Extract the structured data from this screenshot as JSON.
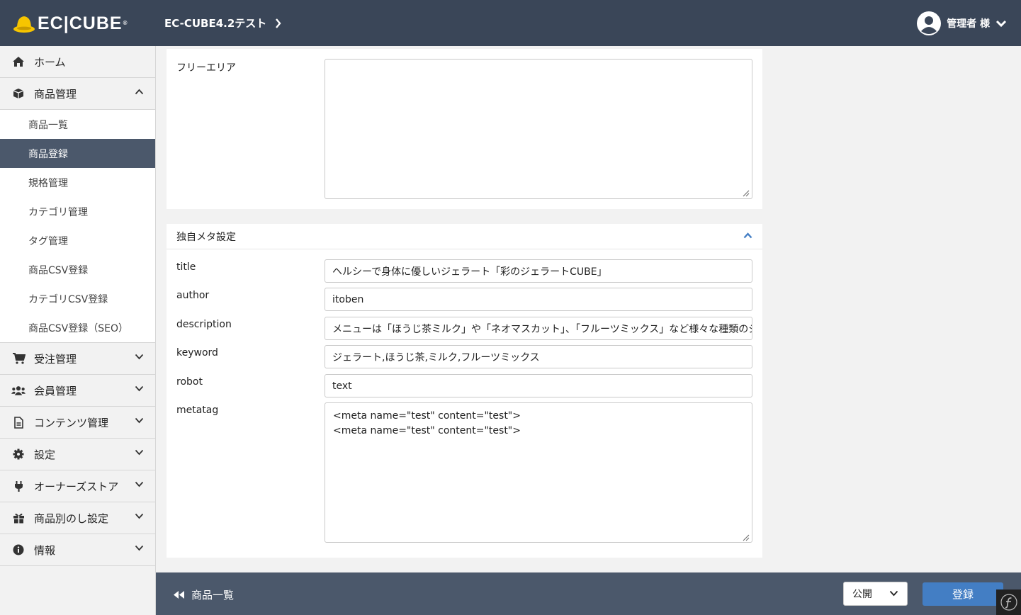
{
  "header": {
    "logo_text": "EC|CUBE",
    "logo_reg": "®",
    "shop_name": "EC-CUBE4.2テスト",
    "user_label": "管理者 様"
  },
  "sidebar": {
    "items": [
      {
        "label": "ホーム",
        "icon": "home-icon"
      },
      {
        "label": "商品管理",
        "icon": "box-icon",
        "expanded": true,
        "children": [
          "商品一覧",
          "商品登録",
          "規格管理",
          "カテゴリ管理",
          "タグ管理",
          "商品CSV登録",
          "カテゴリCSV登録",
          "商品CSV登録（SEO）"
        ],
        "active_child": "商品登録"
      },
      {
        "label": "受注管理",
        "icon": "cart-icon"
      },
      {
        "label": "会員管理",
        "icon": "users-icon"
      },
      {
        "label": "コンテンツ管理",
        "icon": "file-icon"
      },
      {
        "label": "設定",
        "icon": "gear-icon"
      },
      {
        "label": "オーナーズストア",
        "icon": "plug-icon"
      },
      {
        "label": "商品別のし設定",
        "icon": "gift-icon"
      },
      {
        "label": "情報",
        "icon": "info-icon"
      }
    ]
  },
  "free_area": {
    "label": "フリーエリア",
    "value": ""
  },
  "meta_section": {
    "title": "独自メタ設定",
    "fields": {
      "title": {
        "label": "title",
        "value": "ヘルシーで身体に優しいジェラート「彩のジェラートCUBE」"
      },
      "author": {
        "label": "author",
        "value": "itoben"
      },
      "description": {
        "label": "description",
        "value": "メニューは「ほうじ茶ミルク」や「ネオマスカット」、「フルーツミックス」など様々な種類のジェラートが用意されていま"
      },
      "keyword": {
        "label": "keyword",
        "value": "ジェラート,ほうじ茶,ミルク,フルーツミックス"
      },
      "robot": {
        "label": "robot",
        "value": "text"
      },
      "metatag": {
        "label": "metatag",
        "value": "<meta name=\"test\" content=\"test\">\n<meta name=\"test\" content=\"test\">"
      }
    }
  },
  "footer": {
    "back_label": "商品一覧",
    "status_selected": "公開",
    "submit_label": "登録"
  },
  "colors": {
    "header_bg": "#3a4658",
    "footer_bg": "#4b586b",
    "active_bg": "#4b586b",
    "primary": "#437ec4"
  }
}
